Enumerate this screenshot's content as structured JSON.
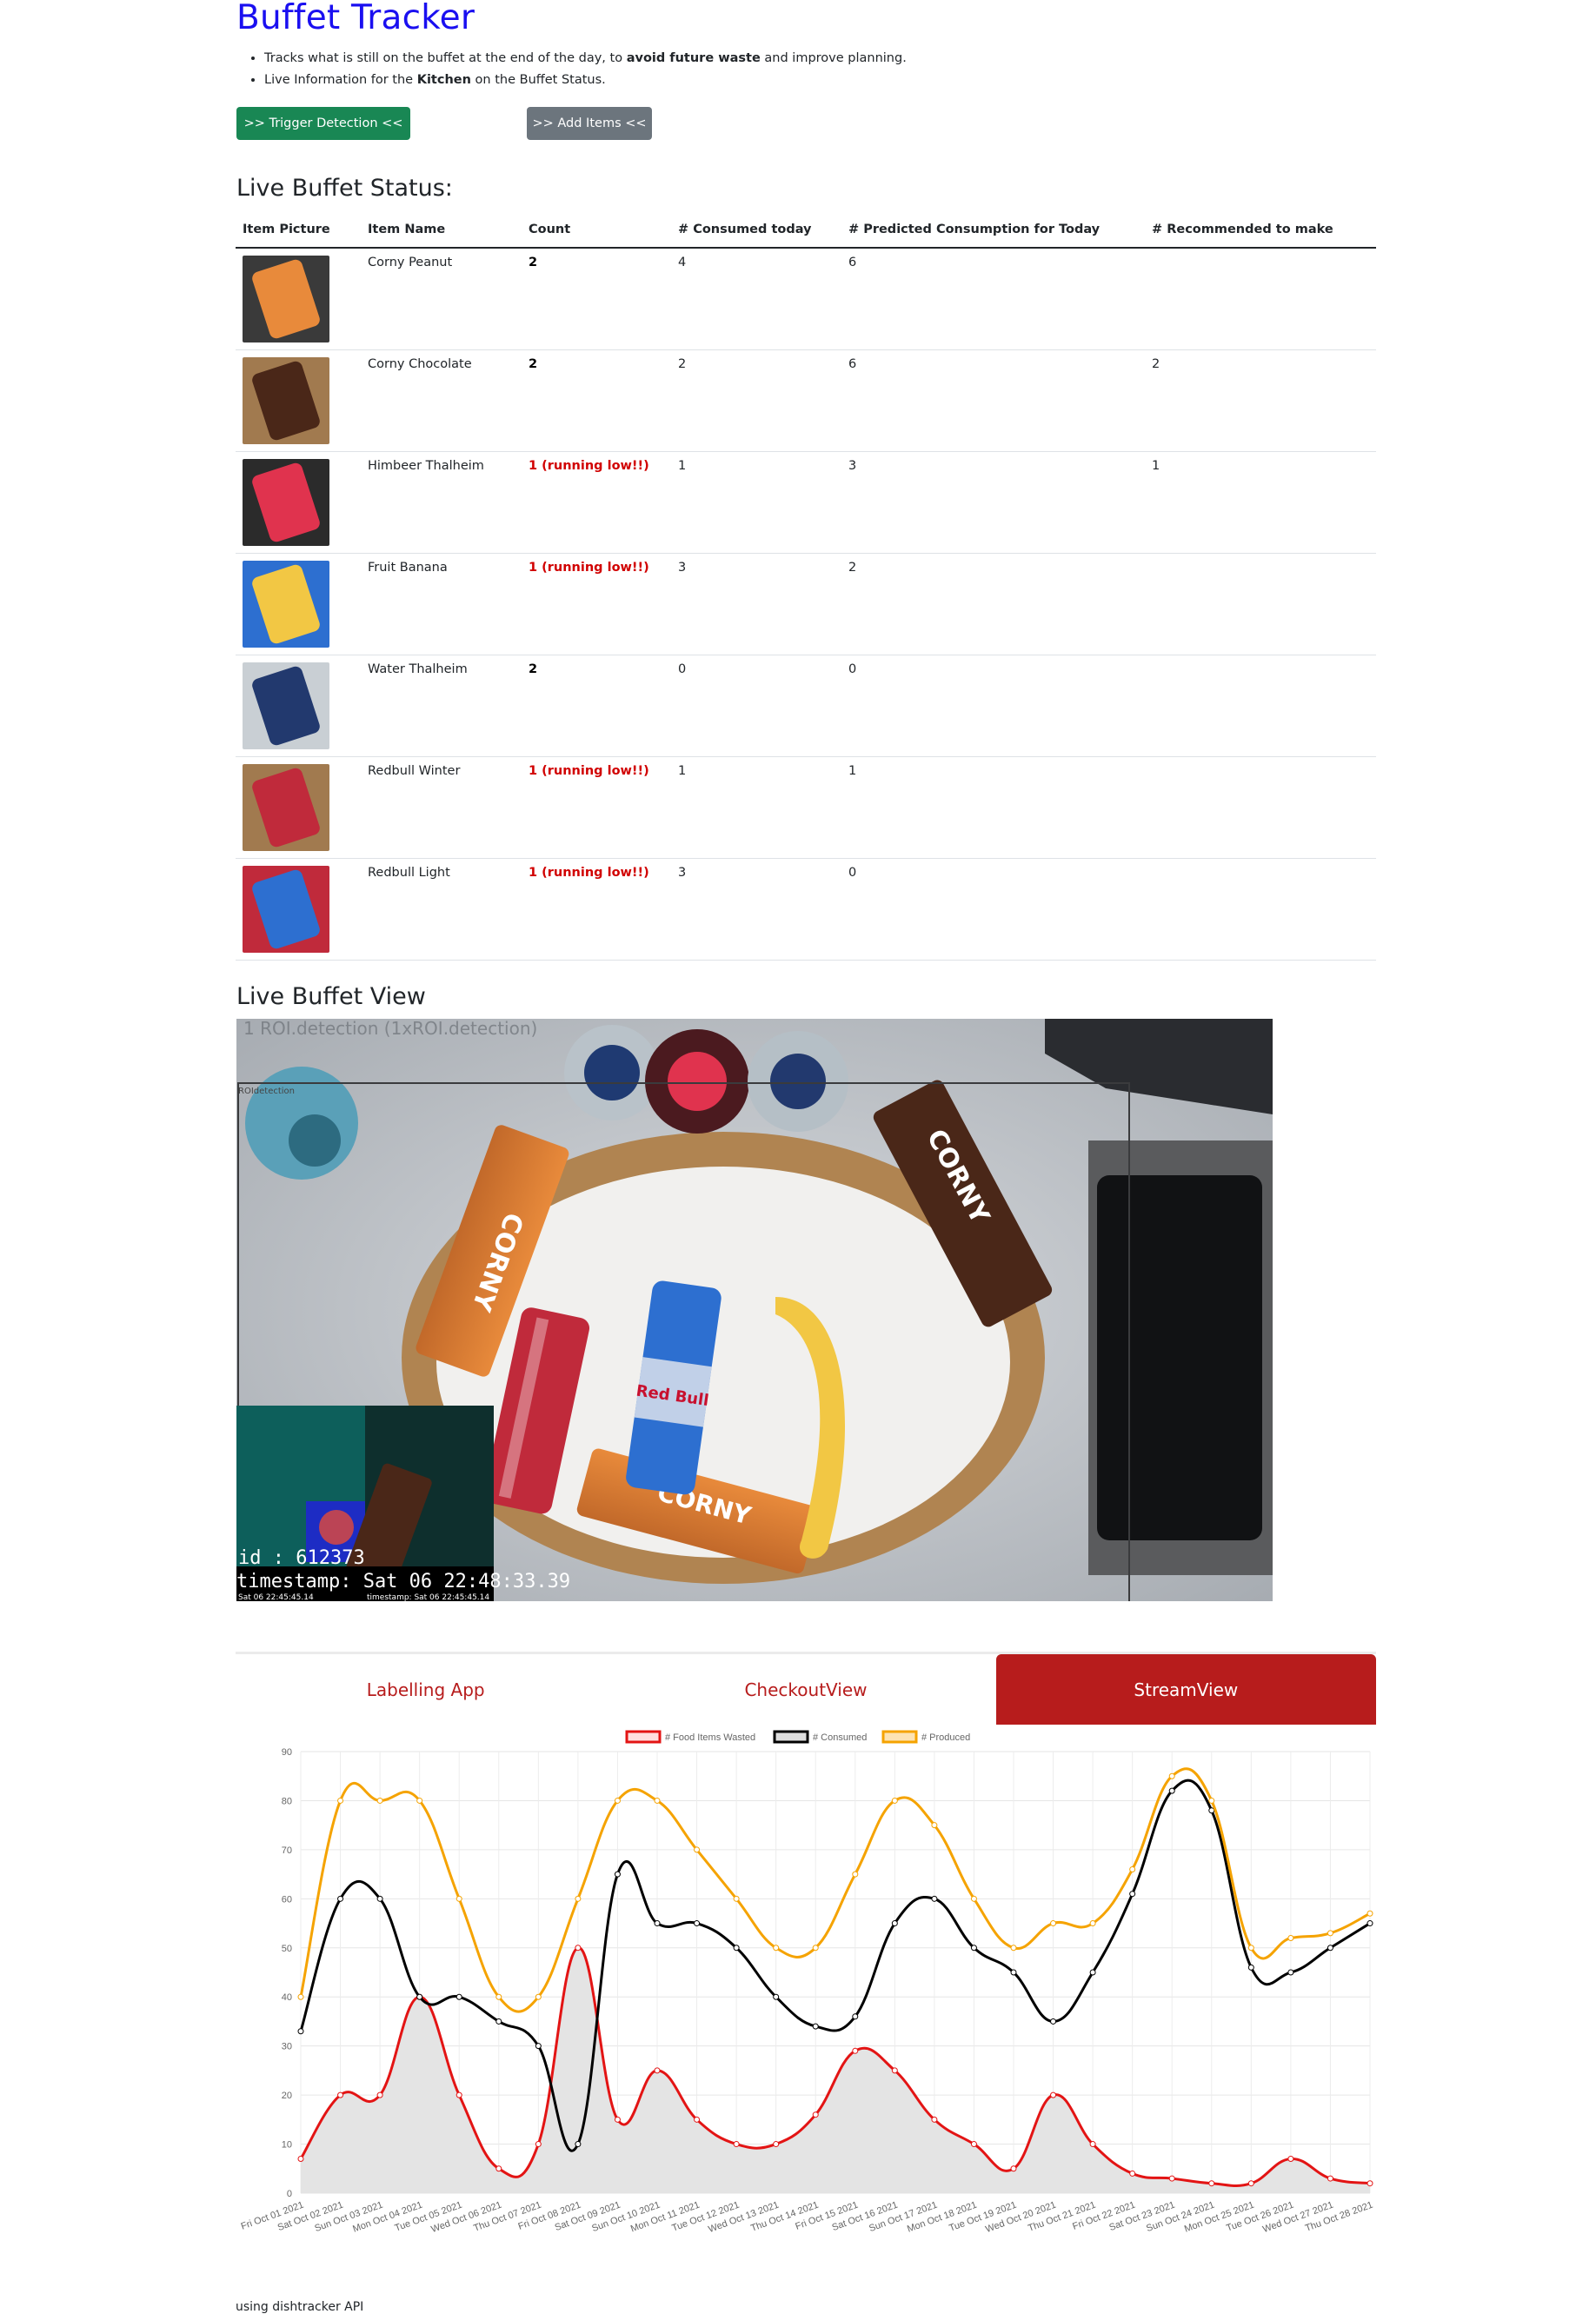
{
  "header": {
    "title": "Buffet Tracker",
    "bullet1": {
      "pre": "Tracks what is still on the buffet at the end of the day, to ",
      "bold": "avoid future waste",
      "post": " and improve planning."
    },
    "bullet2": {
      "pre": "Live Information for the ",
      "bold": "Kitchen",
      "post": " on the Buffet Status."
    }
  },
  "buttons": {
    "trigger": ">> Trigger Detection <<",
    "add": ">> Add Items <<"
  },
  "status": {
    "heading": "Live Buffet Status:",
    "columns": [
      "Item Picture",
      "Item Name",
      "Count",
      "# Consumed today",
      "# Predicted Consumption for Today",
      "# Recommended to make"
    ],
    "rows": [
      {
        "name": "Corny Peanut",
        "count": "2",
        "low": false,
        "consumed": "4",
        "predicted": "6",
        "recommended": ""
      },
      {
        "name": "Corny Chocolate",
        "count": "2",
        "low": false,
        "consumed": "2",
        "predicted": "6",
        "recommended": "2"
      },
      {
        "name": "Himbeer Thalheim",
        "count": "1 (running low!!)",
        "low": true,
        "consumed": "1",
        "predicted": "3",
        "recommended": "1"
      },
      {
        "name": "Fruit Banana",
        "count": "1 (running low!!)",
        "low": true,
        "consumed": "3",
        "predicted": "2",
        "recommended": ""
      },
      {
        "name": "Water Thalheim",
        "count": "2",
        "low": false,
        "consumed": "0",
        "predicted": "0",
        "recommended": ""
      },
      {
        "name": "Redbull Winter",
        "count": "1 (running low!!)",
        "low": true,
        "consumed": "1",
        "predicted": "1",
        "recommended": ""
      },
      {
        "name": "Redbull Light",
        "count": "1 (running low!!)",
        "low": true,
        "consumed": "3",
        "predicted": "0",
        "recommended": ""
      }
    ]
  },
  "view": {
    "heading": "Live Buffet View",
    "overlay_top": "1 ROI.detection (1xROI.detection)",
    "overlay_roi": "ROIdetection",
    "overlay_id": "id : 612373",
    "overlay_ts": "timestamp: Sat 06 22:48:33.39",
    "overlay_ts_small": "Sat 06 22:45:45.14",
    "overlay_ts_small2": "timestamp: Sat 06 22:45:45.14"
  },
  "tabs": [
    "Labelling App",
    "CheckoutView",
    "StreamView"
  ],
  "active_tab": "StreamView",
  "colors": {
    "wasted": "#e31414",
    "consumed": "#000000",
    "produced": "#f5a300",
    "fill": "#e4e4e4",
    "tab": "#b71c1c"
  },
  "chart_data": {
    "type": "line",
    "x": [
      "Fri Oct 01 2021",
      "Sat Oct 02 2021",
      "Sun Oct 03 2021",
      "Mon Oct 04 2021",
      "Tue Oct 05 2021",
      "Wed Oct 06 2021",
      "Thu Oct 07 2021",
      "Fri Oct 08 2021",
      "Sat Oct 09 2021",
      "Sun Oct 10 2021",
      "Mon Oct 11 2021",
      "Tue Oct 12 2021",
      "Wed Oct 13 2021",
      "Thu Oct 14 2021",
      "Fri Oct 15 2021",
      "Sat Oct 16 2021",
      "Sun Oct 17 2021",
      "Mon Oct 18 2021",
      "Tue Oct 19 2021",
      "Wed Oct 20 2021",
      "Thu Oct 21 2021",
      "Fri Oct 22 2021",
      "Sat Oct 23 2021",
      "Sun Oct 24 2021",
      "Mon Oct 25 2021",
      "Tue Oct 26 2021",
      "Wed Oct 27 2021",
      "Thu Oct 28 2021"
    ],
    "series": [
      {
        "name": "# Food Items Wasted",
        "values": [
          7,
          20,
          20,
          40,
          20,
          5,
          10,
          50,
          15,
          25,
          15,
          10,
          10,
          16,
          29,
          25,
          15,
          10,
          5,
          20,
          10,
          4,
          3,
          2,
          2,
          7,
          3,
          2
        ]
      },
      {
        "name": "# Consumed",
        "values": [
          33,
          60,
          60,
          40,
          40,
          35,
          30,
          10,
          65,
          55,
          55,
          50,
          40,
          34,
          36,
          55,
          60,
          50,
          45,
          35,
          45,
          61,
          82,
          78,
          46,
          45,
          50,
          55
        ]
      },
      {
        "name": "# Produced",
        "values": [
          40,
          80,
          80,
          80,
          60,
          40,
          40,
          60,
          80,
          80,
          70,
          60,
          50,
          50,
          65,
          80,
          75,
          60,
          50,
          55,
          55,
          66,
          85,
          80,
          50,
          52,
          53,
          57
        ]
      }
    ],
    "ylim": [
      0,
      90
    ],
    "yticks": [
      "0",
      "10",
      "20",
      "30",
      "40",
      "50",
      "60",
      "70",
      "80",
      "90"
    ],
    "legend": "top",
    "grid": true
  },
  "footer": "using dishtracker API"
}
